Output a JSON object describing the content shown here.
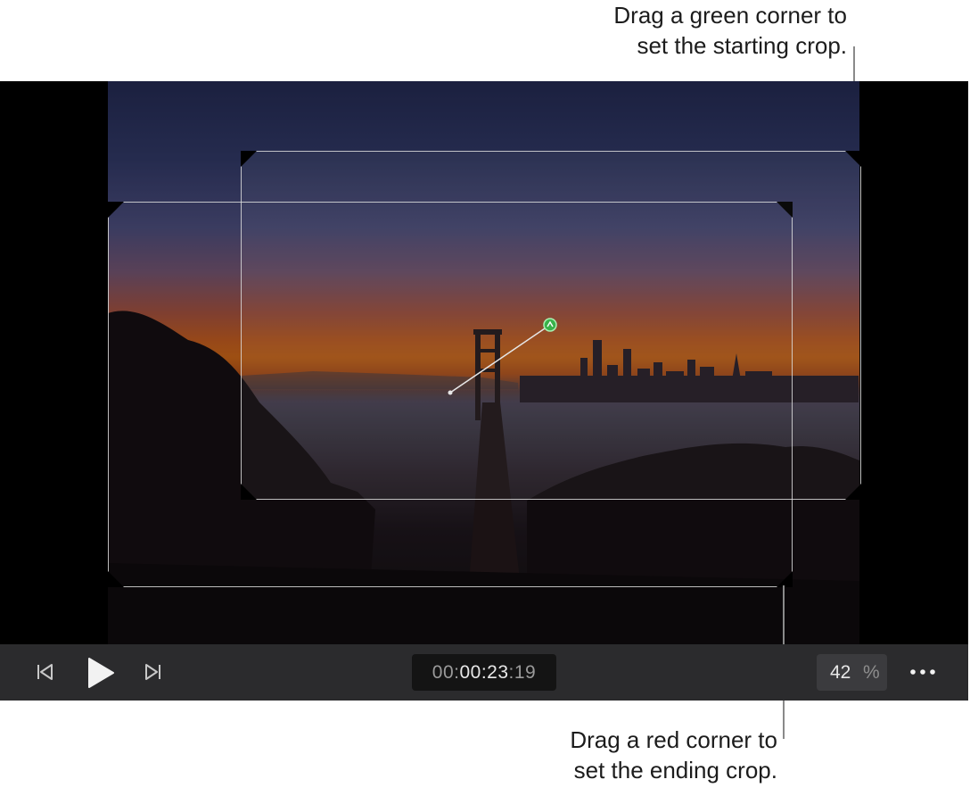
{
  "callouts": {
    "top_line1": "Drag a green corner to",
    "top_line2": "set the starting crop.",
    "bottom_line1": "Drag a red corner to",
    "bottom_line2": "set the ending crop."
  },
  "transport": {
    "timecode_prefix": "00:",
    "timecode_main": "00:23",
    "timecode_sep": ":",
    "timecode_frames": "19",
    "zoom_value": "42",
    "zoom_unit": "%"
  },
  "icons": {
    "prev": "skip-back-icon",
    "play": "play-icon",
    "next": "skip-forward-icon",
    "more": "more-icon"
  },
  "colors": {
    "start_corner": "#3aa853",
    "end_corner": "#a83228"
  }
}
